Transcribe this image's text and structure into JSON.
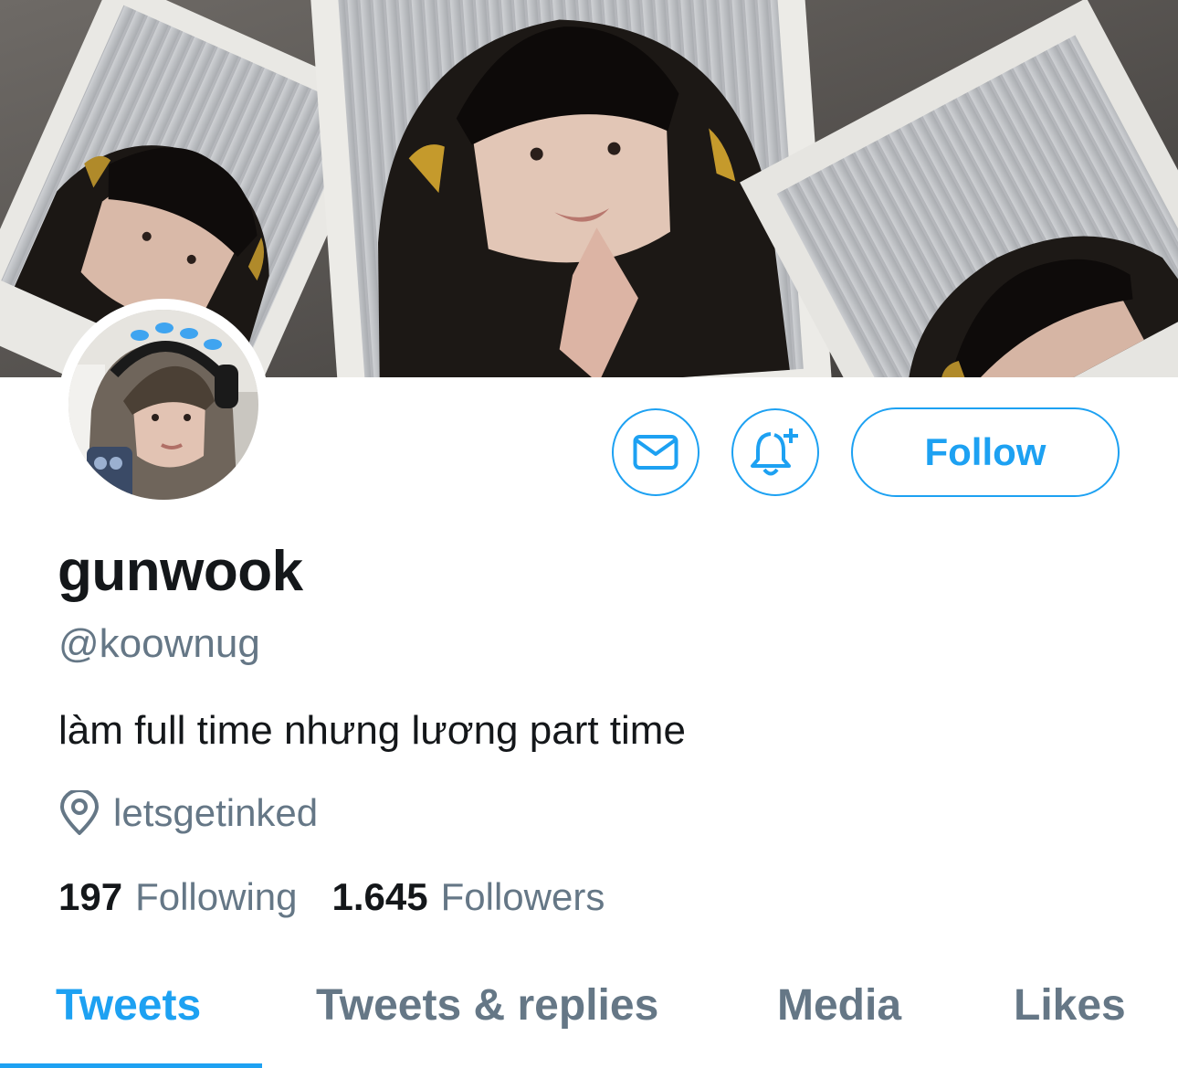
{
  "profile": {
    "display_name": "gunwook",
    "handle": "@koownug",
    "bio": "làm full time nhưng lương part time",
    "location": "letsgetinked"
  },
  "actions": {
    "message_icon": "envelope-icon",
    "notify_icon": "bell-plus-icon",
    "follow_label": "Follow"
  },
  "stats": {
    "following_count": "197",
    "following_label": "Following",
    "followers_count": "1.645",
    "followers_label": "Followers"
  },
  "tabs": [
    {
      "label": "Tweets",
      "active": true
    },
    {
      "label": "Tweets & replies",
      "active": false
    },
    {
      "label": "Media",
      "active": false
    },
    {
      "label": "Likes",
      "active": false
    }
  ],
  "colors": {
    "accent": "#1da1f2",
    "text_primary": "#14171a",
    "text_secondary": "#657786"
  }
}
